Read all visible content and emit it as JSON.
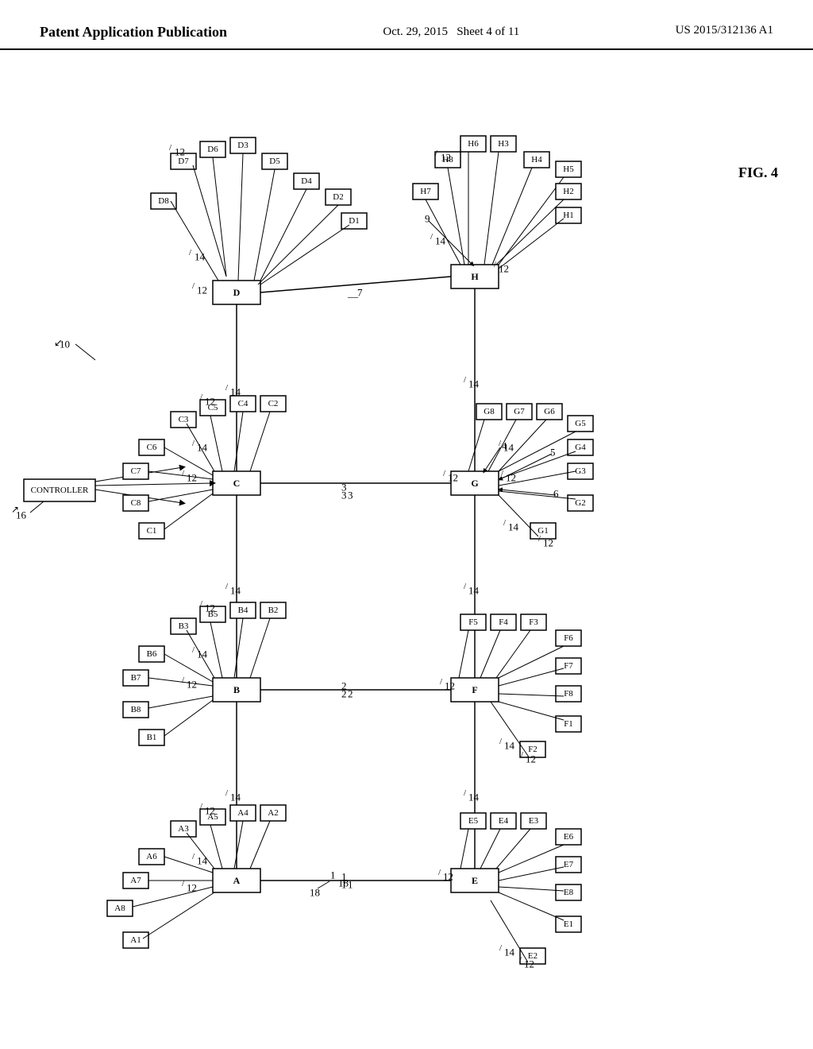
{
  "header": {
    "left_label": "Patent Application Publication",
    "center_date": "Oct. 29, 2015",
    "center_sheet": "Sheet 4 of 11",
    "right_patent": "US 2015/312136 A1",
    "fig_label": "FIG. 4"
  },
  "diagram": {
    "title": "Network topology diagram with hubs A-H and devices",
    "hubs": [
      "A",
      "B",
      "C",
      "D",
      "E",
      "F",
      "G",
      "H"
    ],
    "controller_label": "CONTROLLER",
    "ref_numbers": {
      "main": "10",
      "hub_ref": "12",
      "link_ref": "14",
      "node_ref": "18",
      "controller_ref": "16"
    }
  }
}
